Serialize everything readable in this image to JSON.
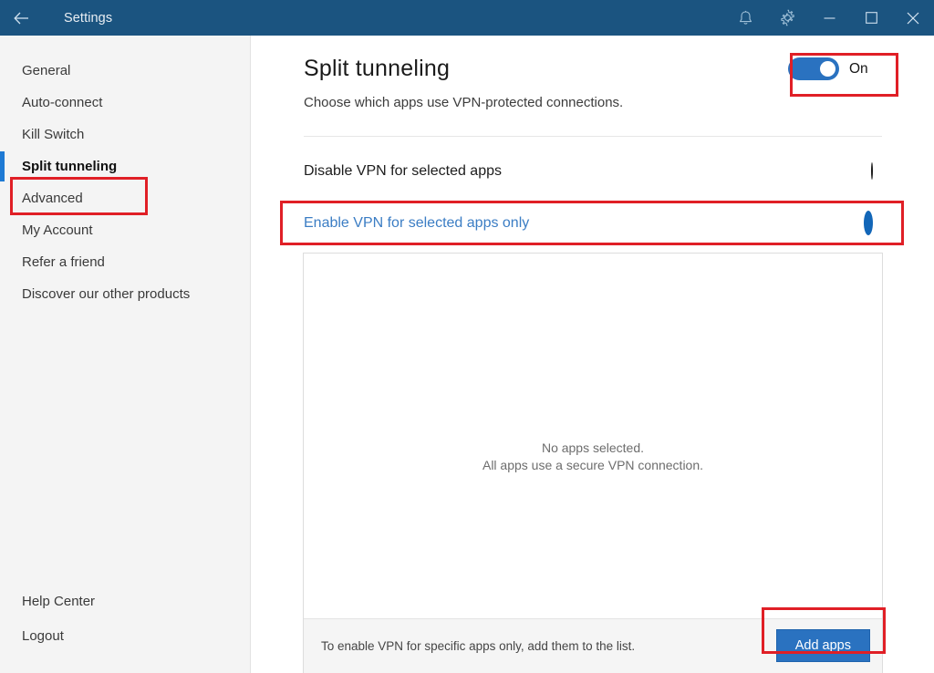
{
  "titlebar": {
    "back_icon": "back-arrow-icon",
    "title": "Settings",
    "bell_icon": "notification-bell-icon",
    "gear_icon": "gear-icon",
    "minimize_icon": "minimize-icon",
    "maximize_icon": "maximize-icon",
    "close_icon": "close-icon",
    "background_color": "#1b5480"
  },
  "sidebar": {
    "items": [
      {
        "label": "General",
        "active": false
      },
      {
        "label": "Auto-connect",
        "active": false
      },
      {
        "label": "Kill Switch",
        "active": false
      },
      {
        "label": "Split tunneling",
        "active": true
      },
      {
        "label": "Advanced",
        "active": false
      },
      {
        "label": "My Account",
        "active": false
      },
      {
        "label": "Refer a friend",
        "active": false
      },
      {
        "label": "Discover our other products",
        "active": false
      }
    ],
    "bottom_items": [
      {
        "label": "Help Center"
      },
      {
        "label": "Logout"
      }
    ],
    "active_indicator_color": "#1e7ad4",
    "background_color": "#f4f4f4"
  },
  "main": {
    "title": "Split tunneling",
    "subtitle": "Choose which apps use VPN-protected connections.",
    "toggle": {
      "state_label": "On",
      "checked": true,
      "color": "#2a72c0"
    },
    "options": [
      {
        "label": "Disable VPN for selected apps",
        "selected": false
      },
      {
        "label": "Enable VPN for selected apps only",
        "selected": true
      }
    ],
    "app_list": {
      "empty_line_1": "No apps selected.",
      "empty_line_2": "All apps use a secure VPN connection.",
      "footer_hint": "To enable VPN for specific apps only, add them to the list.",
      "add_button_label": "Add apps",
      "add_button_color": "#2a72c0"
    }
  },
  "annotations": {
    "color": "#e01f26",
    "boxes": [
      {
        "target": "split-tunneling-toggle"
      },
      {
        "target": "sidebar-item-split-tunneling"
      },
      {
        "target": "option-enable-vpn-selected-apps-only"
      },
      {
        "target": "add-apps-button"
      }
    ]
  }
}
